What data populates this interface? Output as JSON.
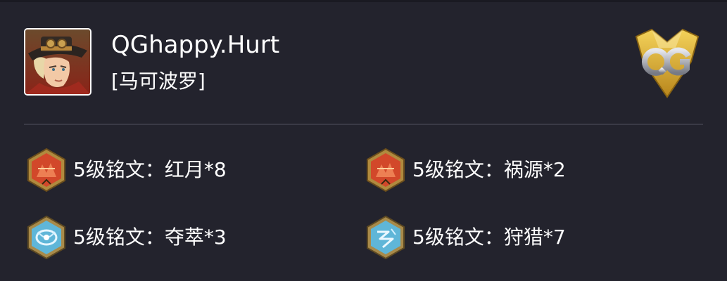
{
  "player": {
    "name": "QGhappy.Hurt",
    "hero": "[马可波罗]"
  },
  "team_logo": {
    "text": "QG",
    "colors": {
      "gold": "#e0b02c",
      "silver": "#b9bcc4"
    }
  },
  "runes": [
    {
      "label": "5级铭文：红月*8",
      "color": "red",
      "icon": "red-rune-icon"
    },
    {
      "label": "5级铭文：祸源*2",
      "color": "red",
      "icon": "red-rune-icon"
    },
    {
      "label": "5级铭文：夺萃*3",
      "color": "blue",
      "icon": "blue-rune-icon"
    },
    {
      "label": "5级铭文：狩猎*7",
      "color": "blue",
      "icon": "blue-rune-icon"
    }
  ],
  "colors": {
    "background": "#23232d",
    "divider": "#3a3a46",
    "text": "#ffffff"
  }
}
